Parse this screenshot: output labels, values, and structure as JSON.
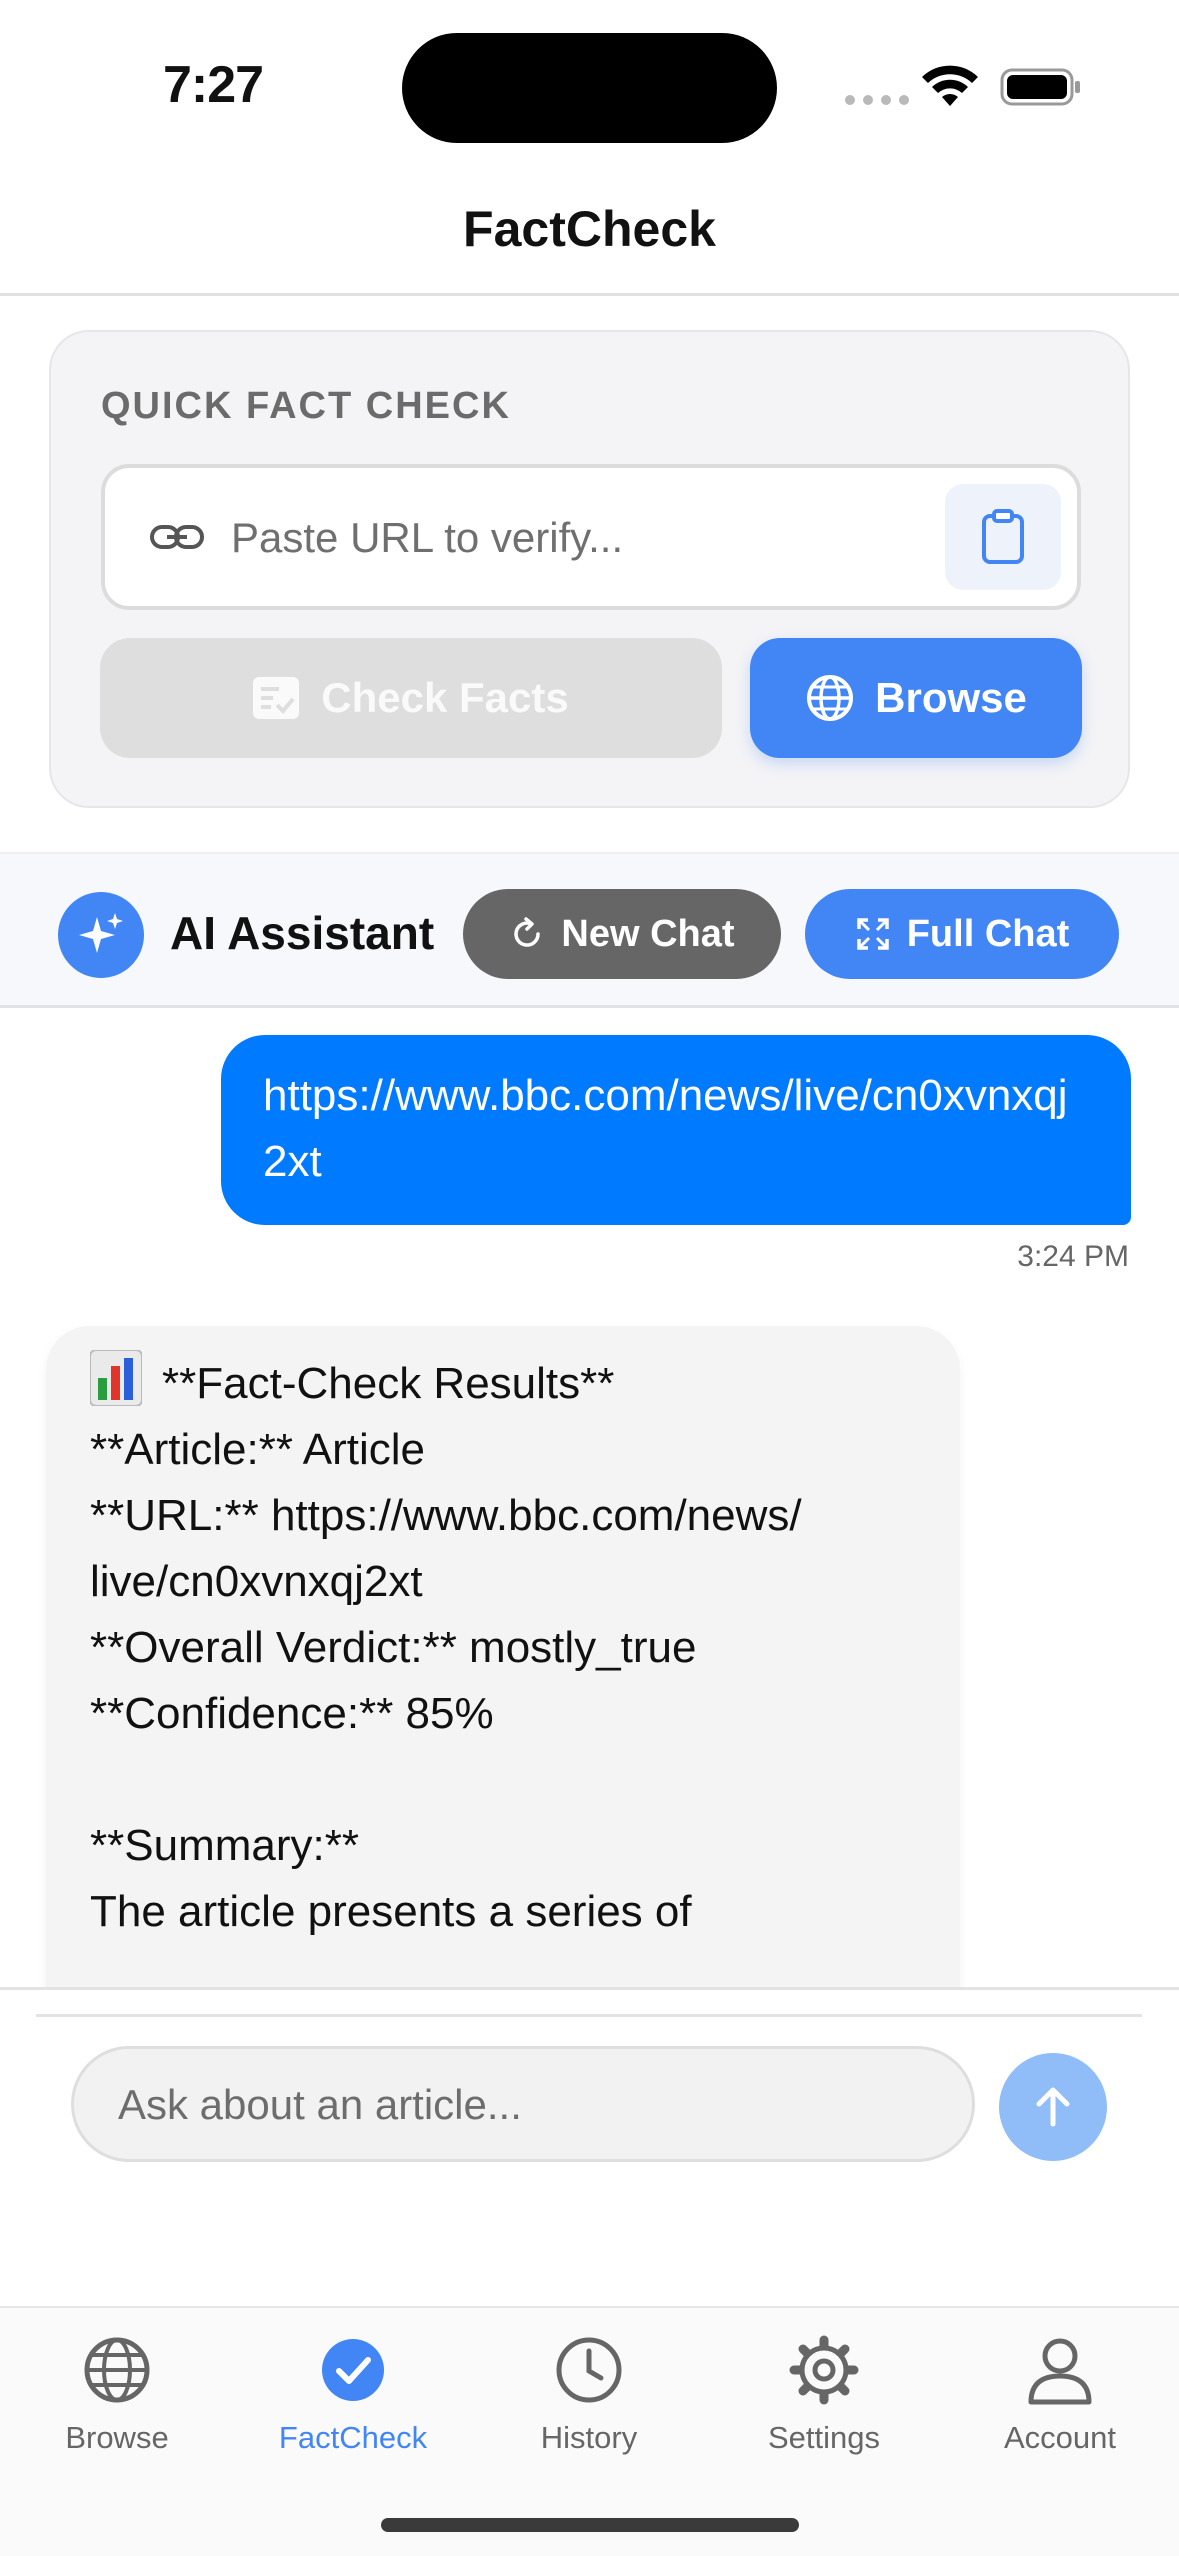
{
  "status_bar": {
    "time": "7:27"
  },
  "nav": {
    "title": "FactCheck"
  },
  "quick_fact_check": {
    "title": "QUICK FACT CHECK",
    "url_placeholder": "Paste URL to verify...",
    "check_label": "Check Facts",
    "browse_label": "Browse"
  },
  "assistant": {
    "title": "AI Assistant",
    "new_chat_label": "New Chat",
    "full_chat_label": "Full Chat"
  },
  "messages": {
    "user_text": "https://www.bbc.com/news/live/cn0xvnxqj2xt",
    "user_time": "3:24 PM",
    "ai_heading": "**Fact-Check Results**",
    "ai_body": "\n**Article:** Article\n**URL:** https://www.bbc.com/news/\nlive/cn0xvnxqj2xt\n**Overall Verdict:** mostly_true\n**Confidence:** 85%\n\n**Summary:**\nThe article presents a series of"
  },
  "composer": {
    "placeholder": "Ask about an article..."
  },
  "tabs": [
    {
      "label": "Browse",
      "icon": "globe-icon",
      "active": false
    },
    {
      "label": "FactCheck",
      "icon": "checkmark-circle-icon",
      "active": true
    },
    {
      "label": "History",
      "icon": "clock-icon",
      "active": false
    },
    {
      "label": "Settings",
      "icon": "gear-icon",
      "active": false
    },
    {
      "label": "Account",
      "icon": "person-icon",
      "active": false
    }
  ],
  "colors": {
    "accent": "#4285f4",
    "user_bubble": "#007aff",
    "new_chat": "#666666"
  }
}
